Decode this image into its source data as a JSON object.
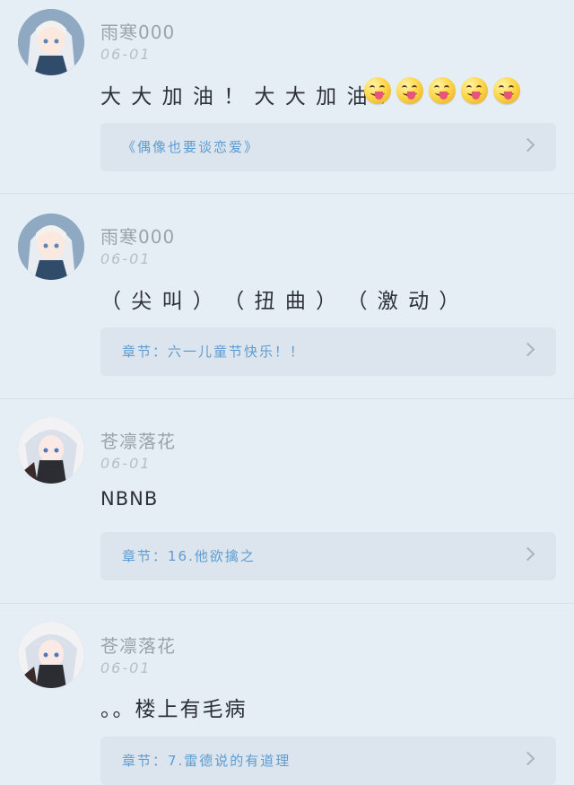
{
  "comments": [
    {
      "username": "雨寒000",
      "date": "06-01",
      "content": "大 大 加 油 ！ 大 大 加 油 ！",
      "emojis": [
        "yum-face-emoji",
        "yum-face-emoji",
        "yum-face-emoji",
        "yum-face-emoji",
        "yum-face-emoji"
      ],
      "reference": "《偶像也要谈恋爱》"
    },
    {
      "username": "雨寒000",
      "date": "06-01",
      "content": "（ 尖 叫 ） （ 扭 曲 ） （ 激 动 ）",
      "reference": "章节：六一儿童节快乐！！"
    },
    {
      "username": "苍凛落花",
      "date": "06-01",
      "content": "NBNB",
      "reference": "章节：16.他欲擒之"
    },
    {
      "username": "苍凛落花",
      "date": "06-01",
      "content": "。。楼上有毛病",
      "reference": "章节：7.雷德说的有道理"
    }
  ],
  "colors": {
    "background": "#e6eef5",
    "reference_box": "#dce5ee",
    "reference_text": "#5d9bd0",
    "username": "#9aa2ab",
    "content": "#2c3138"
  }
}
